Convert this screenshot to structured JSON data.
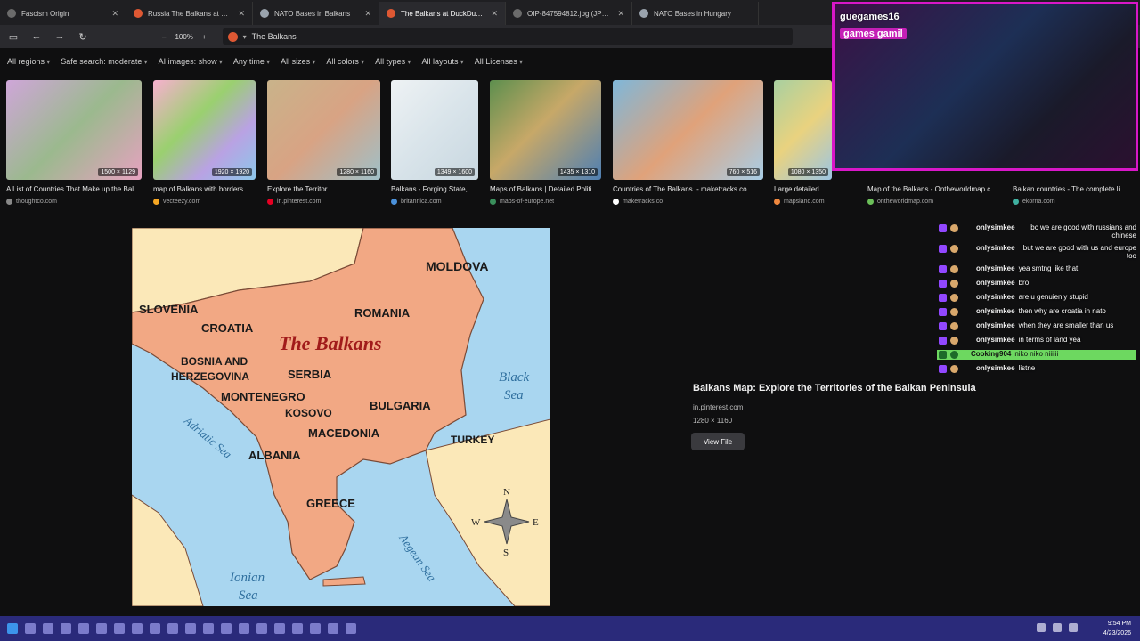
{
  "tabs": [
    {
      "label": "Fascism Origin",
      "favicon": "globe-icon",
      "active": false
    },
    {
      "label": "Russia The Balkans at DuckDuckGo",
      "favicon": "duckduckgo-icon",
      "active": false
    },
    {
      "label": "NATO Bases in Balkans",
      "favicon": "nato-icon",
      "active": false
    },
    {
      "label": "The Balkans at DuckDuckGo",
      "favicon": "duckduckgo-icon",
      "active": true
    },
    {
      "label": "OIP-847594812.jpg (JPEG Image...",
      "favicon": "image-icon",
      "active": false
    },
    {
      "label": "NATO Bases in Hungary",
      "favicon": "nato-icon",
      "active": false
    }
  ],
  "toolbar": {
    "zoom": "100%",
    "url": "The Balkans",
    "zoom_minus": "–",
    "zoom_plus": "+"
  },
  "filters": [
    "All regions",
    "Safe search: moderate",
    "AI images: show",
    "Any time",
    "All sizes",
    "All colors",
    "All types",
    "All layouts",
    "All Licenses"
  ],
  "thumbnails": [
    {
      "title": "A List of Countries That Make up the Bal...",
      "source": "thoughtco.com",
      "dim": "1500 × 1129"
    },
    {
      "title": "map of Balkans with borders ...",
      "source": "vecteezy.com",
      "dim": "1920 × 1920"
    },
    {
      "title": "Explore the Territor...",
      "source": "in.pinterest.com",
      "dim": "1280 × 1160"
    },
    {
      "title": "Balkans - Forging State, ...",
      "source": "britannica.com",
      "dim": "1349 × 1600"
    },
    {
      "title": "Maps of Balkans | Detailed Politi...",
      "source": "maps-of-europe.net",
      "dim": "1435 × 1310"
    },
    {
      "title": "Countries of The Balkans. - maketracks.co",
      "source": "maketracks.co",
      "dim": "760 × 516"
    },
    {
      "title": "Large detailed political ...",
      "source": "mapsland.com",
      "dim": "1080 × 1350"
    },
    {
      "title": "Map of the Balkans - Ontheworldmap.c...",
      "source": "ontheworldmap.com",
      "dim": ""
    },
    {
      "title": "Balkan countries - The complete li...",
      "source": "ekorna.com",
      "dim": ""
    }
  ],
  "map": {
    "title": "The Balkans",
    "countries": [
      "MOLDOVA",
      "SLOVENIA",
      "ROMANIA",
      "CROATIA",
      "BOSNIA AND",
      "HERZEGOVINA",
      "SERBIA",
      "MONTENEGRO",
      "KOSOVO",
      "BULGARIA",
      "MACEDONIA",
      "TURKEY",
      "ALBANIA",
      "GREECE"
    ],
    "seas": [
      "Black",
      "Sea",
      "Adriatic Sea",
      "Aegean Sea",
      "Ionian",
      "Sea"
    ],
    "compass": {
      "n": "N",
      "s": "S",
      "e": "E",
      "w": "W"
    },
    "colors": {
      "land": "#f2a884",
      "neighbor": "#fbe8b8",
      "sea": "#a9d6f0",
      "border": "#7a4a36",
      "title": "#a11a1a",
      "sea_text": "#2f6f9e"
    }
  },
  "detail": {
    "title": "Balkans Map: Explore the Territories of the Balkan Peninsula",
    "source": "in.pinterest.com",
    "dimensions": "1280 × 1160",
    "view_button": "View File"
  },
  "stream": {
    "channel": "guegames16",
    "sub": "games gamil",
    "accent": "#d817c8"
  },
  "chat": [
    {
      "user": "onlysimkee",
      "text": "bc we are good with russians and chinese",
      "highlight": false
    },
    {
      "user": "onlysimkee",
      "text": "but we are good with us and europe too",
      "highlight": false
    },
    {
      "user": "onlysimkee",
      "text": "yea smtng like that",
      "highlight": false
    },
    {
      "user": "onlysimkee",
      "text": "bro",
      "highlight": false
    },
    {
      "user": "onlysimkee",
      "text": "are u genuienly stupid",
      "highlight": false
    },
    {
      "user": "onlysimkee",
      "text": "then why are croatia in nato",
      "highlight": false
    },
    {
      "user": "onlysimkee",
      "text": "when they are smaller than us",
      "highlight": false
    },
    {
      "user": "onlysimkee",
      "text": "in terms of land yea",
      "highlight": false
    },
    {
      "user": "Cooking904",
      "text": "niko niko niiiiii",
      "highlight": true
    },
    {
      "user": "onlysimkee",
      "text": "listne",
      "highlight": false
    }
  ],
  "taskbar": {
    "time": "9:54 PM",
    "date": "4/23/2026"
  }
}
